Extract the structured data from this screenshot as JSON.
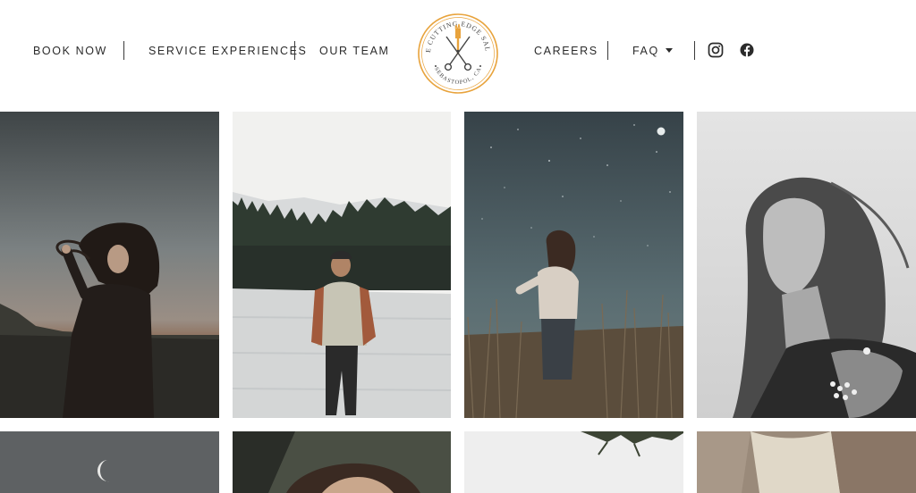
{
  "nav": {
    "left": [
      {
        "label": "BOOK NOW"
      },
      {
        "label": "SERVICE EXPERIENCES"
      },
      {
        "label": "OUR TEAM"
      }
    ],
    "right": [
      {
        "label": "CAREERS"
      },
      {
        "label": "FAQ"
      }
    ]
  },
  "logo": {
    "top_text": "THE CUTTING EDGE SALON",
    "bottom_text": "SEBASTOPOL, CA",
    "accent_color": "#e8a33c"
  },
  "social": [
    "instagram-icon",
    "facebook-icon"
  ],
  "gallery": [
    {
      "subject": "woman-wind-blown-hair-dusk"
    },
    {
      "subject": "smiling-man-plaid-shirt-by-lake"
    },
    {
      "subject": "woman-in-tall-grass-starry-sky"
    },
    {
      "subject": "woman-bw-portrait-looking-up"
    },
    {
      "subject": "crescent-moon-grey-sky"
    },
    {
      "subject": "woman-in-car-window"
    },
    {
      "subject": "branches-pale-sky"
    },
    {
      "subject": "person-with-scarf"
    }
  ]
}
